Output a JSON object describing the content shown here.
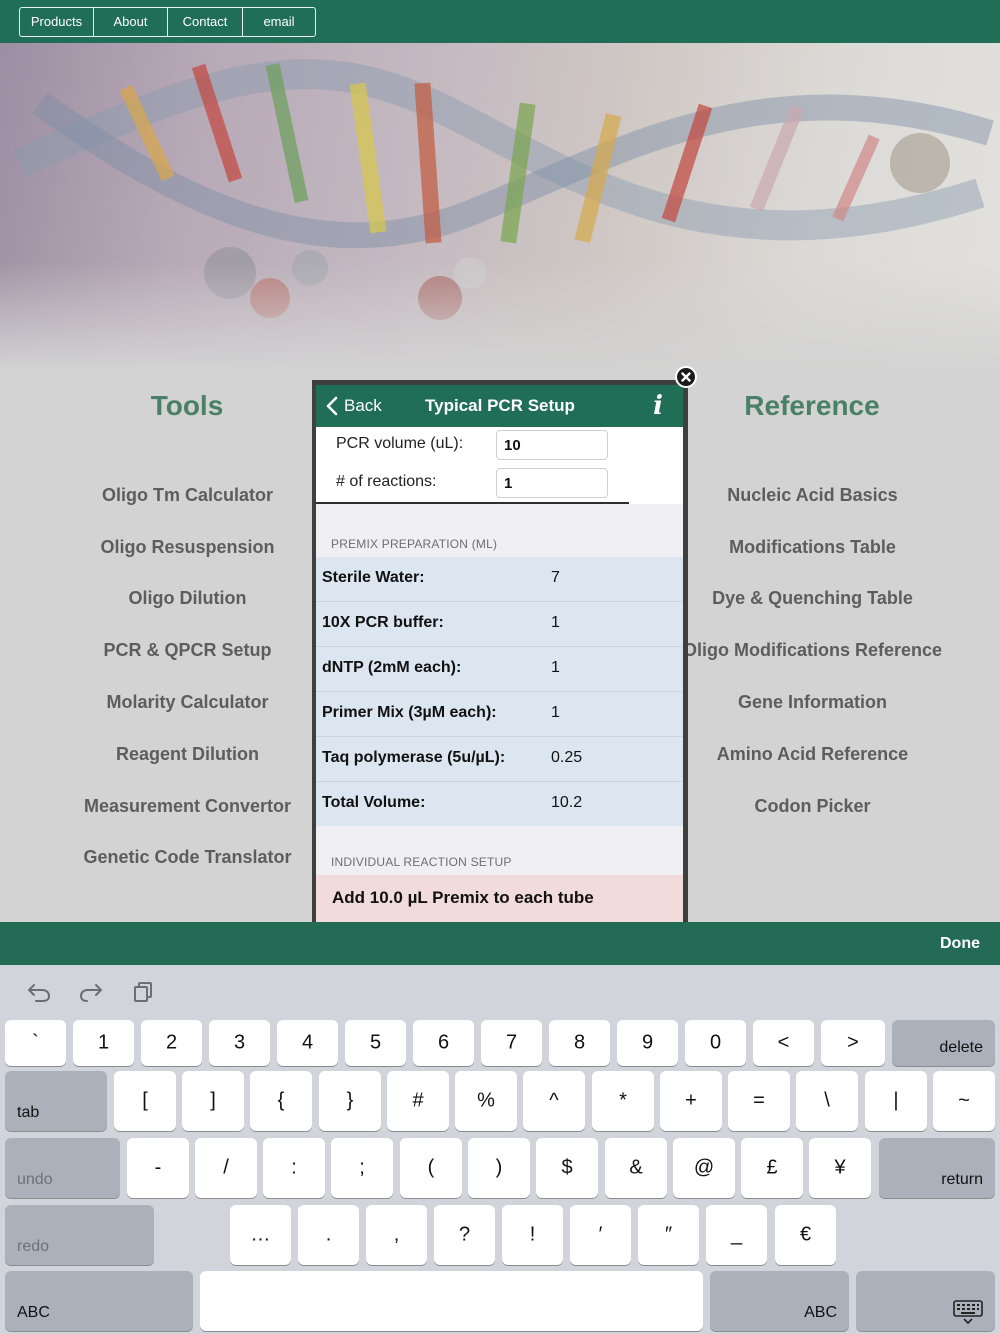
{
  "top_nav": {
    "items": [
      "Products",
      "About",
      "Contact",
      "email"
    ]
  },
  "tools": {
    "title": "Tools",
    "items": [
      "Oligo Tm Calculator",
      "Oligo Resuspension",
      "Oligo Dilution",
      "PCR & QPCR Setup",
      "Molarity Calculator",
      "Reagent Dilution",
      "Measurement Convertor",
      "Genetic Code Translator"
    ]
  },
  "reference": {
    "title": "Reference",
    "items": [
      "Nucleic Acid Basics",
      "Modifications Table",
      "Dye & Quenching Table",
      "Oligo Modifications Reference",
      "Gene Information",
      "Amino Acid Reference",
      "Codon Picker"
    ]
  },
  "modal": {
    "back_label": "Back",
    "title": "Typical PCR Setup",
    "info_icon": "i",
    "inputs": [
      {
        "label": "PCR volume (uL):",
        "value": "10"
      },
      {
        "label": "# of reactions:",
        "value": "1"
      }
    ],
    "premix_header": "PREMIX PREPARATION (ML)",
    "premix_rows": [
      {
        "label": "Sterile Water:",
        "value": "7"
      },
      {
        "label": "10X PCR buffer:",
        "value": "1"
      },
      {
        "label": "dNTP (2mM each):",
        "value": "1"
      },
      {
        "label": "Primer Mix (3µM each):",
        "value": "1"
      },
      {
        "label": "Taq polymerase (5u/µL):",
        "value": "0.25"
      },
      {
        "label": "Total Volume:",
        "value": "10.2"
      }
    ],
    "individual_header": "INDIVIDUAL REACTION SETUP",
    "instruction": "Add 10.0 µL Premix to each tube"
  },
  "done_bar": {
    "done_label": "Done"
  },
  "keyboard": {
    "toolbar_icons": [
      "undo-icon",
      "redo-icon",
      "paste-icon"
    ],
    "row1": [
      "`",
      "1",
      "2",
      "3",
      "4",
      "5",
      "6",
      "7",
      "8",
      "9",
      "0",
      "<",
      ">"
    ],
    "row1_end": "delete",
    "row2_start": "tab",
    "row2": [
      "[",
      "]",
      "{",
      "}",
      "#",
      "%",
      "^",
      "*",
      "+",
      "=",
      "\\",
      "|",
      "~"
    ],
    "row3_start": "undo",
    "row3": [
      "-",
      "/",
      ":",
      ";",
      "(",
      ")",
      "$",
      "&",
      "@",
      "£",
      "¥"
    ],
    "row3_end": "return",
    "row4_start": "redo",
    "row4": [
      "…",
      ".",
      ",",
      "?",
      "!",
      "′",
      "″",
      "_",
      "€"
    ],
    "row5_start": "ABC",
    "row5_mid": "ABC",
    "dismiss_icon": "keyboard-dismiss-icon"
  }
}
